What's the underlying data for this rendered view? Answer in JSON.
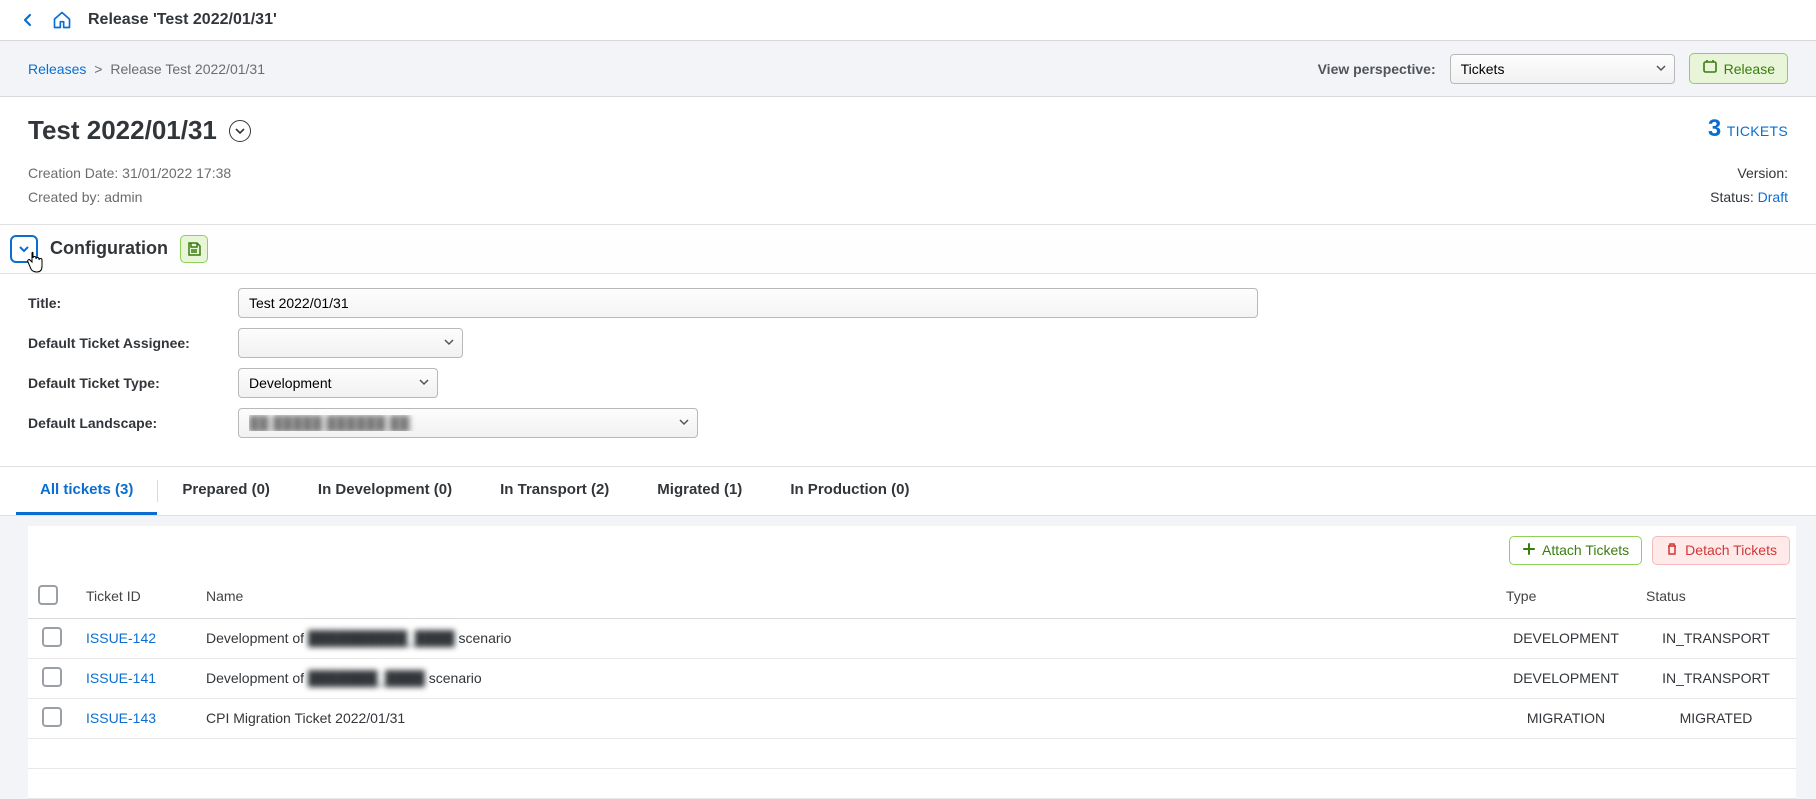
{
  "topbar": {
    "title": "Release 'Test 2022/01/31'"
  },
  "breadcrumb": {
    "root": "Releases",
    "sep": ">",
    "current": "Release Test 2022/01/31"
  },
  "perspective": {
    "label": "View perspective:",
    "value": "Tickets"
  },
  "releaseButton": "Release",
  "header": {
    "title": "Test 2022/01/31",
    "ticketsCount": "3",
    "ticketsLabel": "TICKETS",
    "creationDateLabel": "Creation Date:",
    "creationDate": "31/01/2022 17:38",
    "createdByLabel": "Created by:",
    "createdBy": "admin",
    "versionLabel": "Version:",
    "statusLabel": "Status:",
    "statusValue": "Draft"
  },
  "config": {
    "section": "Configuration",
    "titleLabel": "Title:",
    "titleValue": "Test 2022/01/31",
    "assigneeLabel": "Default Ticket Assignee:",
    "assigneeValue": "",
    "typeLabel": "Default Ticket Type:",
    "typeValue": "Development",
    "landscapeLabel": "Default Landscape:",
    "landscapeValue": "██ █████ ██████ ██"
  },
  "tabs": {
    "all": "All tickets (3)",
    "prepared": "Prepared (0)",
    "inDev": "In Development (0)",
    "inTransport": "In Transport (2)",
    "migrated": "Migrated (1)",
    "inProd": "In Production (0)"
  },
  "tableToolbar": {
    "attach": "Attach Tickets",
    "detach": "Detach Tickets"
  },
  "columns": {
    "ticketId": "Ticket ID",
    "name": "Name",
    "type": "Type",
    "status": "Status"
  },
  "rows": [
    {
      "id": "ISSUE-142",
      "namePrefix": "Development of ",
      "nameRedacted": "██████████_████",
      "nameSuffix": " scenario",
      "type": "DEVELOPMENT",
      "status": "IN_TRANSPORT"
    },
    {
      "id": "ISSUE-141",
      "namePrefix": "Development of ",
      "nameRedacted": "███████_████",
      "nameSuffix": " scenario",
      "type": "DEVELOPMENT",
      "status": "IN_TRANSPORT"
    },
    {
      "id": "ISSUE-143",
      "namePrefix": "CPI Migration Ticket 2022/01/31",
      "nameRedacted": "",
      "nameSuffix": "",
      "type": "MIGRATION",
      "status": "MIGRATED"
    }
  ]
}
